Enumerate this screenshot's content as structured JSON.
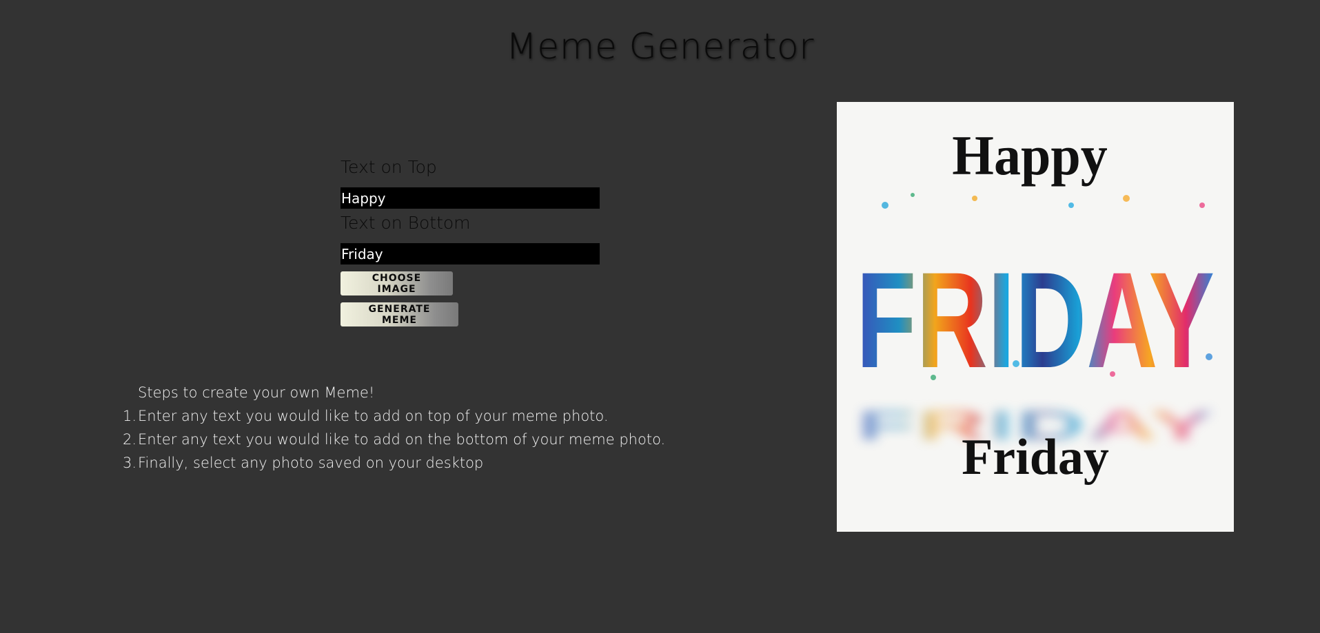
{
  "header": {
    "title": "Meme Generator"
  },
  "form": {
    "top_label": "Text on Top",
    "top_value": "Happy",
    "bottom_label": "Text on Bottom",
    "bottom_value": "Friday",
    "choose_image_label": "CHOOSE IMAGE",
    "generate_label": "GENERATE MEME"
  },
  "steps": {
    "heading": "Steps to create your own Meme!",
    "items": [
      {
        "num": "1.",
        "text": "Enter any text you would like to add on top of your meme photo."
      },
      {
        "num": "2.",
        "text": "Enter any text you would like to add on the bottom of your meme photo."
      },
      {
        "num": "3.",
        "text": "Finally, select any photo saved on your desktop"
      }
    ]
  },
  "meme_preview": {
    "image_text": "FRIDAY",
    "top_text": "Happy",
    "bottom_text": "Friday"
  },
  "colors": {
    "background": "#333333",
    "input_background": "#000000",
    "meme_background": "#f6f6f4"
  }
}
